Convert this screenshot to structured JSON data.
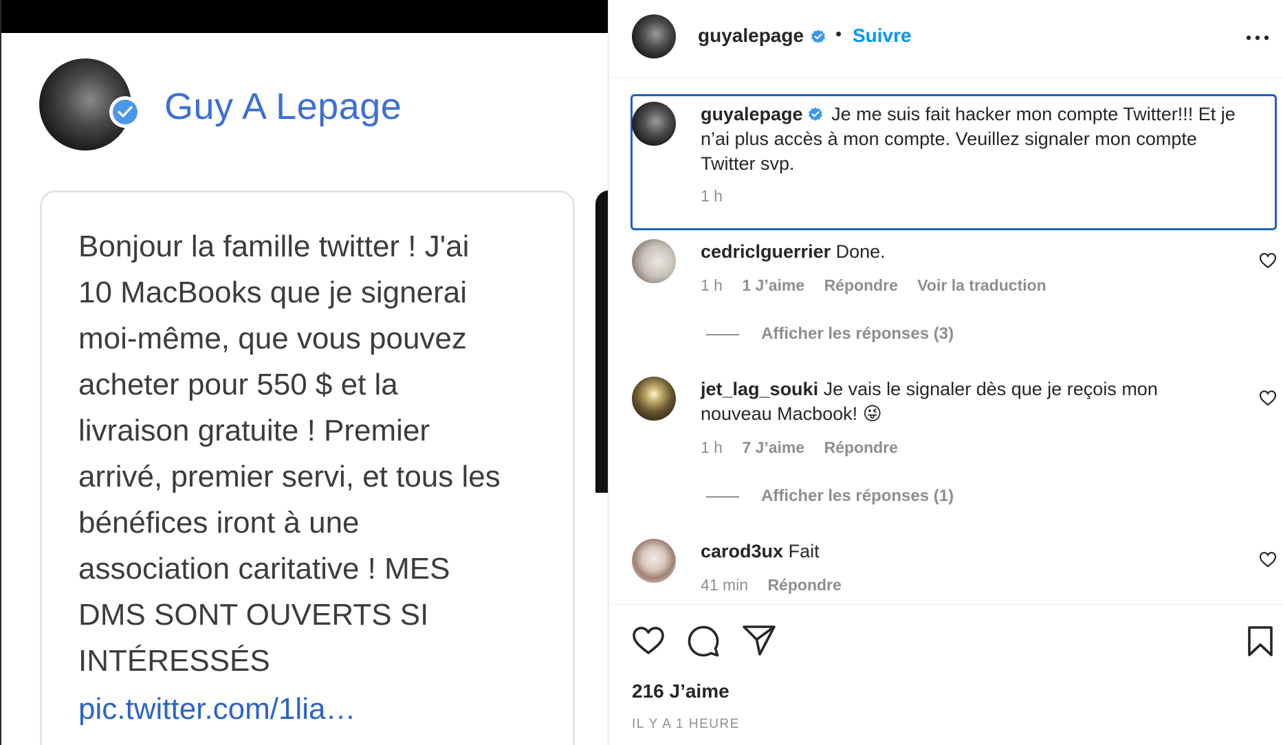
{
  "tweet": {
    "author_name": "Guy A Lepage",
    "text_lines": [
      "Bonjour la famille twitter ! J'ai",
      "10 MacBooks que je signerai",
      "moi-même, que vous pouvez",
      "acheter pour 550 $ et la",
      "livraison gratuite ! Premier",
      "arrivé, premier servi, et tous les",
      "bénéfices iront à une",
      "association caritative ! MES",
      "DMS SONT OUVERTS SI",
      "INTÉRESSÉS"
    ],
    "link": "pic.twitter.com/1lia…"
  },
  "post": {
    "username": "guyalepage",
    "follow_label": "Suivre",
    "separator": "•",
    "caption": {
      "username": "guyalepage",
      "text": "Je me suis fait hacker mon compte Twitter!!! Et je n’ai plus accès à mon compte. Veuillez signaler mon compte Twitter svp.",
      "time": "1 h"
    },
    "comments": [
      {
        "username": "cedriclguerrier",
        "text": "Done.",
        "time": "1 h",
        "likes": "1 J’aime",
        "reply": "Répondre",
        "translate": "Voir la traduction",
        "view_replies": "Afficher les réponses (3)"
      },
      {
        "username": "jet_lag_souki",
        "text": "Je vais le signaler dès que je reçois mon nouveau Macbook! 😜",
        "time": "1 h",
        "likes": "7 J’aime",
        "reply": "Répondre",
        "view_replies": "Afficher les réponses (1)"
      },
      {
        "username": "carod3ux",
        "text": "Fait",
        "time": "41 min",
        "reply": "Répondre"
      }
    ],
    "likes_label": "216 J’aime",
    "timestamp": "IL Y A 1 HEURE"
  },
  "icons": {
    "verified": "verified-badge-icon",
    "more": "more-options-icon",
    "like": "heart-icon",
    "comment": "comment-bubble-icon",
    "share": "paper-plane-icon",
    "save": "bookmark-icon"
  },
  "colors": {
    "instagram_blue": "#0095f6",
    "verified_blue": "#3897f0",
    "twitter_name_blue": "#3a6fd8",
    "link_blue": "#2b63c9",
    "muted_gray": "#8e8e8e",
    "focus_border": "#1f5fbf"
  }
}
